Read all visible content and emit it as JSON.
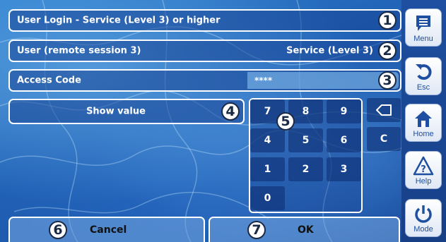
{
  "rows": {
    "title": "User Login - Service (Level 3) or higher",
    "user_label": "User (remote session 3)",
    "user_value": "Service (Level 3)",
    "access_label": "Access Code",
    "access_value": "****",
    "show_value": "Show value"
  },
  "badges": [
    "1",
    "2",
    "3",
    "4",
    "5",
    "6",
    "7"
  ],
  "keypad": {
    "keys": [
      "7",
      "8",
      "9",
      "4",
      "5",
      "6",
      "1",
      "2",
      "3",
      "0"
    ],
    "backspace_icon": "backspace-arrow-icon",
    "clear": "C"
  },
  "bottom": {
    "cancel": "Cancel",
    "ok": "OK"
  },
  "sidebar": {
    "menu": "Menu",
    "esc": "Esc",
    "home": "Home",
    "help": "Help",
    "mode": "Mode"
  },
  "colors": {
    "accent": "#1f4fa0",
    "background": "#1f5fb3",
    "border": "#ffffff"
  }
}
